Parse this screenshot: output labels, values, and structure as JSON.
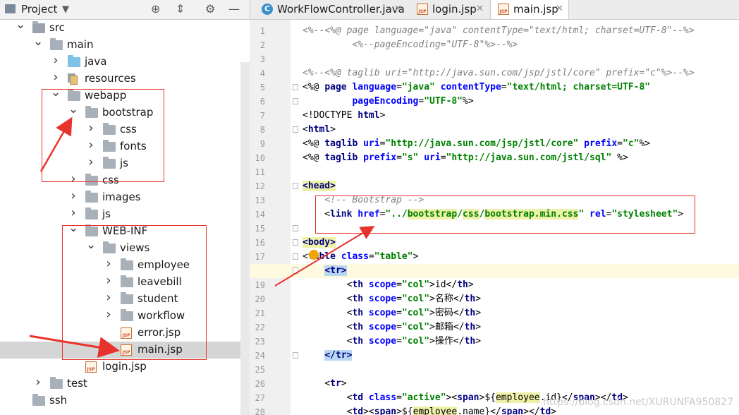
{
  "project_panel": {
    "title": "Project",
    "tree": [
      {
        "label": "src",
        "icon": "module-folder-icon",
        "arrow": "expanded"
      },
      {
        "label": "main",
        "icon": "folder-icon",
        "arrow": "expanded"
      },
      {
        "label": "java",
        "icon": "source-folder-icon",
        "arrow": "collapsed"
      },
      {
        "label": "resources",
        "icon": "resources-folder-icon",
        "arrow": "collapsed"
      },
      {
        "label": "webapp",
        "icon": "folder-icon",
        "arrow": "expanded"
      },
      {
        "label": "bootstrap",
        "icon": "folder-icon",
        "arrow": "expanded"
      },
      {
        "label": "css",
        "icon": "folder-icon",
        "arrow": "collapsed"
      },
      {
        "label": "fonts",
        "icon": "folder-icon",
        "arrow": "collapsed"
      },
      {
        "label": "js",
        "icon": "folder-icon",
        "arrow": "collapsed"
      },
      {
        "label": "css",
        "icon": "folder-icon",
        "arrow": "collapsed"
      },
      {
        "label": "images",
        "icon": "folder-icon",
        "arrow": "collapsed"
      },
      {
        "label": "js",
        "icon": "folder-icon",
        "arrow": "collapsed"
      },
      {
        "label": "WEB-INF",
        "icon": "folder-icon",
        "arrow": "expanded"
      },
      {
        "label": "views",
        "icon": "folder-icon",
        "arrow": "expanded"
      },
      {
        "label": "employee",
        "icon": "folder-icon",
        "arrow": "collapsed"
      },
      {
        "label": "leavebill",
        "icon": "folder-icon",
        "arrow": "collapsed"
      },
      {
        "label": "student",
        "icon": "folder-icon",
        "arrow": "collapsed"
      },
      {
        "label": "workflow",
        "icon": "folder-icon",
        "arrow": "collapsed"
      },
      {
        "label": "error.jsp",
        "icon": "jsp-file-icon",
        "arrow": "none"
      },
      {
        "label": "main.jsp",
        "icon": "jsp-file-icon",
        "arrow": "none",
        "selected": true
      },
      {
        "label": "login.jsp",
        "icon": "jsp-file-icon",
        "arrow": "none"
      },
      {
        "label": "test",
        "icon": "folder-icon",
        "arrow": "collapsed"
      },
      {
        "label": "ssh",
        "icon": "folder-icon",
        "arrow": "none"
      }
    ]
  },
  "tabs": [
    {
      "label": "WorkFlowController.java",
      "icon": "java-class-icon",
      "active": false
    },
    {
      "label": "login.jsp",
      "icon": "jsp-file-icon",
      "active": false
    },
    {
      "label": "main.jsp",
      "icon": "jsp-file-icon",
      "active": true
    }
  ],
  "editor": {
    "current_line": 18,
    "lines": [
      {
        "n": "1",
        "parts": [
          [
            "com",
            "<%--<%@ page language=\"java\" contentType=\"text/html; charset=UTF-8\"--%>"
          ]
        ]
      },
      {
        "n": "2",
        "parts": [
          [
            "com",
            "         <%--pageEncoding=\"UTF-8\"%>--%>"
          ]
        ]
      },
      {
        "n": "3",
        "parts": []
      },
      {
        "n": "4",
        "parts": [
          [
            "com",
            "<%--<%@ taglib uri=\"http://java.sun.com/jsp/jstl/core\" prefix=\"c\"%>--%>"
          ]
        ]
      },
      {
        "n": "5",
        "parts": [
          [
            "text",
            "<%@ "
          ],
          [
            "tag",
            "page"
          ],
          [
            "attr",
            " language"
          ],
          [
            "text",
            "="
          ],
          [
            "val",
            "\"java\""
          ],
          [
            "attr",
            " contentType"
          ],
          [
            "text",
            "="
          ],
          [
            "val",
            "\"text/html; charset=UTF-8\""
          ]
        ]
      },
      {
        "n": "6",
        "parts": [
          [
            "text",
            "         "
          ],
          [
            "attr",
            "pageEncoding"
          ],
          [
            "text",
            "="
          ],
          [
            "val",
            "\"UTF-8\""
          ],
          [
            "text",
            "%>"
          ]
        ]
      },
      {
        "n": "7",
        "parts": [
          [
            "text",
            "<!DOCTYPE "
          ],
          [
            "tag",
            "html"
          ],
          [
            "text",
            ">"
          ]
        ]
      },
      {
        "n": "8",
        "parts": [
          [
            "text",
            "<"
          ],
          [
            "tag",
            "html"
          ],
          [
            "text",
            ">"
          ]
        ]
      },
      {
        "n": "9",
        "parts": [
          [
            "text",
            "<%@ "
          ],
          [
            "tag",
            "taglib"
          ],
          [
            "attr",
            " uri"
          ],
          [
            "text",
            "="
          ],
          [
            "val",
            "\"http://java.sun.com/jsp/jstl/core\""
          ],
          [
            "attr",
            " prefix"
          ],
          [
            "text",
            "="
          ],
          [
            "val",
            "\"c\""
          ],
          [
            "text",
            "%>"
          ]
        ]
      },
      {
        "n": "10",
        "parts": [
          [
            "text",
            "<%@ "
          ],
          [
            "tag",
            "taglib"
          ],
          [
            "attr",
            " prefix"
          ],
          [
            "text",
            "="
          ],
          [
            "val",
            "\"s\""
          ],
          [
            "attr",
            " uri"
          ],
          [
            "text",
            "="
          ],
          [
            "val",
            "\"http://java.sun.com/jstl/sql\""
          ],
          [
            "text",
            " %>"
          ]
        ]
      },
      {
        "n": "11",
        "parts": []
      },
      {
        "n": "12",
        "parts": [
          [
            "tagy",
            "<head>"
          ]
        ]
      },
      {
        "n": "13",
        "parts": [
          [
            "text",
            "    "
          ],
          [
            "com",
            "<!-- Bootstrap -->"
          ]
        ]
      },
      {
        "n": "14",
        "parts": [
          [
            "text",
            "    <"
          ],
          [
            "tag",
            "link"
          ],
          [
            "attr",
            " href"
          ],
          [
            "text",
            "="
          ],
          [
            "val",
            "\"../"
          ],
          [
            "hlg",
            "bootstrap"
          ],
          [
            "val",
            "/"
          ],
          [
            "hlg",
            "css"
          ],
          [
            "val",
            "/"
          ],
          [
            "hlg",
            "bootstrap.min.css"
          ],
          [
            "val",
            "\""
          ],
          [
            "attr",
            " rel"
          ],
          [
            "text",
            "="
          ],
          [
            "val",
            "\"stylesheet\""
          ],
          [
            "text",
            ">"
          ]
        ]
      },
      {
        "n": "15",
        "parts": []
      },
      {
        "n": "16",
        "parts": [
          [
            "tagy",
            "<body>"
          ]
        ]
      },
      {
        "n": "17",
        "parts": [
          [
            "text",
            "<"
          ],
          [
            "tag",
            "table"
          ],
          [
            "attr",
            " class"
          ],
          [
            "text",
            "="
          ],
          [
            "val",
            "\"table\""
          ],
          [
            "text",
            ">"
          ]
        ]
      },
      {
        "n": "18",
        "parts": [
          [
            "text",
            "    "
          ],
          [
            "tagh",
            "<tr>"
          ]
        ]
      },
      {
        "n": "19",
        "parts": [
          [
            "text",
            "        <"
          ],
          [
            "tag",
            "th"
          ],
          [
            "attr",
            " scope"
          ],
          [
            "text",
            "="
          ],
          [
            "val",
            "\"col\""
          ],
          [
            "text",
            ">id</"
          ],
          [
            "tag",
            "th"
          ],
          [
            "text",
            ">"
          ]
        ]
      },
      {
        "n": "20",
        "parts": [
          [
            "text",
            "        <"
          ],
          [
            "tag",
            "th"
          ],
          [
            "attr",
            " scope"
          ],
          [
            "text",
            "="
          ],
          [
            "val",
            "\"col\""
          ],
          [
            "text",
            ">名称</"
          ],
          [
            "tag",
            "th"
          ],
          [
            "text",
            ">"
          ]
        ]
      },
      {
        "n": "21",
        "parts": [
          [
            "text",
            "        <"
          ],
          [
            "tag",
            "th"
          ],
          [
            "attr",
            " scope"
          ],
          [
            "text",
            "="
          ],
          [
            "val",
            "\"col\""
          ],
          [
            "text",
            ">密码</"
          ],
          [
            "tag",
            "th"
          ],
          [
            "text",
            ">"
          ]
        ]
      },
      {
        "n": "22",
        "parts": [
          [
            "text",
            "        <"
          ],
          [
            "tag",
            "th"
          ],
          [
            "attr",
            " scope"
          ],
          [
            "text",
            "="
          ],
          [
            "val",
            "\"col\""
          ],
          [
            "text",
            ">邮箱</"
          ],
          [
            "tag",
            "th"
          ],
          [
            "text",
            ">"
          ]
        ]
      },
      {
        "n": "23",
        "parts": [
          [
            "text",
            "        <"
          ],
          [
            "tag",
            "th"
          ],
          [
            "attr",
            " scope"
          ],
          [
            "text",
            "="
          ],
          [
            "val",
            "\"col\""
          ],
          [
            "text",
            ">操作</"
          ],
          [
            "tag",
            "th"
          ],
          [
            "text",
            ">"
          ]
        ]
      },
      {
        "n": "24",
        "parts": [
          [
            "text",
            "    "
          ],
          [
            "tagh",
            "</tr>"
          ]
        ]
      },
      {
        "n": "25",
        "parts": []
      },
      {
        "n": "26",
        "parts": [
          [
            "text",
            "    <"
          ],
          [
            "tag",
            "tr"
          ],
          [
            "text",
            ">"
          ]
        ]
      },
      {
        "n": "27",
        "parts": [
          [
            "text",
            "        <"
          ],
          [
            "tag",
            "td"
          ],
          [
            "attr",
            " class"
          ],
          [
            "text",
            "="
          ],
          [
            "val",
            "\"active\""
          ],
          [
            "text",
            "><"
          ],
          [
            "tag",
            "span"
          ],
          [
            "text",
            ">${"
          ],
          [
            "hl",
            "employee"
          ],
          [
            "text",
            ".id}</"
          ],
          [
            "tag",
            "span"
          ],
          [
            "text",
            "></"
          ],
          [
            "tag",
            "td"
          ],
          [
            "text",
            ">"
          ]
        ]
      },
      {
        "n": "28",
        "parts": [
          [
            "text",
            "        <"
          ],
          [
            "tag",
            "td"
          ],
          [
            "text",
            "><"
          ],
          [
            "tag",
            "span"
          ],
          [
            "text",
            ">${"
          ],
          [
            "hl",
            "employee"
          ],
          [
            "text",
            ".name}</"
          ],
          [
            "tag",
            "span"
          ],
          [
            "text",
            "></"
          ],
          [
            "tag",
            "td"
          ],
          [
            "text",
            ">"
          ]
        ]
      }
    ]
  },
  "watermark": "https://blog.csdn.net/XURUNFA950827",
  "colors": {
    "annotation": "#e8332c",
    "selection": "#d5d5d5",
    "current_line": "#fdfae0"
  }
}
